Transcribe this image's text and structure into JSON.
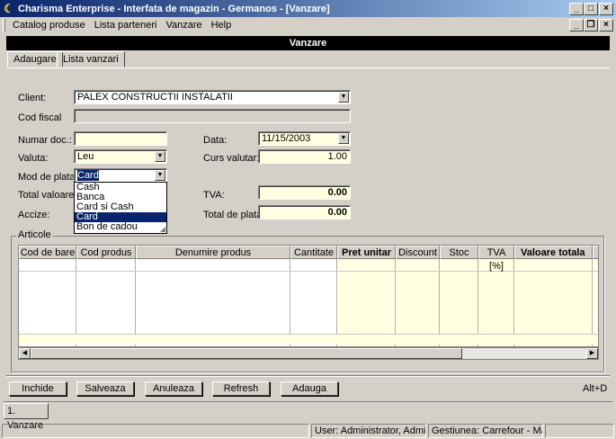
{
  "window": {
    "title": "Charisma Enterprise - Interfata de magazin - Germanos - [Vanzare]",
    "caption_buttons": [
      "_",
      "□",
      "×"
    ],
    "mdi_buttons": [
      "_",
      "❐",
      "×"
    ]
  },
  "menu": {
    "items": [
      "Catalog produse",
      "Lista parteneri",
      "Vanzare",
      "Help"
    ]
  },
  "header": {
    "title": "Vanzare"
  },
  "tabs": [
    {
      "label": "Adaugare",
      "active": true
    },
    {
      "label": "Lista vanzari",
      "active": false
    }
  ],
  "form": {
    "client": {
      "label": "Client:",
      "value": "PALEX CONSTRUCTII INSTALATII"
    },
    "cod_fiscal": {
      "label": "Cod fiscal",
      "value": ""
    },
    "numar_doc": {
      "label": "Numar doc.:",
      "value": ""
    },
    "data": {
      "label": "Data:",
      "value": "11/15/2003"
    },
    "valuta": {
      "label": "Valuta:",
      "value": "Leu"
    },
    "curs_valutar": {
      "label": "Curs valutar:",
      "value": "1.00"
    },
    "mod_de_plata": {
      "label": "Mod de plata:",
      "value": "Card"
    },
    "total_valoare": {
      "label": "Total valoare:"
    },
    "tva": {
      "label": "TVA:",
      "value": "0.00"
    },
    "accize": {
      "label": "Accize:"
    },
    "total_de_plata": {
      "label": "Total de plata:",
      "value": "0.00"
    }
  },
  "mod_de_plata_options": {
    "items": [
      "Cash",
      "Banca",
      "Card si Cash",
      "Card",
      "Bon de cadou"
    ],
    "selected": "Card"
  },
  "articole": {
    "title": "Articole",
    "columns": [
      "Cod de bare",
      "Cod produs",
      "Denumire produs",
      "Cantitate",
      "Pret unitar",
      "Discount",
      "Stoc",
      "TVA [%]",
      "Valoare totala"
    ]
  },
  "buttons": {
    "inchide": "Inchide",
    "salveaza": "Salveaza",
    "anuleaza": "Anuleaza",
    "refresh": "Refresh",
    "adauga": "Adauga",
    "shortcut_hint": "Alt+D"
  },
  "taskbar": {
    "tab": "1. Vanzare"
  },
  "status": {
    "user": "User: Administrator, Administr",
    "gestiune": "Gestiunea: Carrefour - Marfa V"
  },
  "colors": {
    "title_start": "#0a246a",
    "title_end": "#a6caf0",
    "field_yellow": "#ffffe1",
    "selection": "#0a246a"
  }
}
